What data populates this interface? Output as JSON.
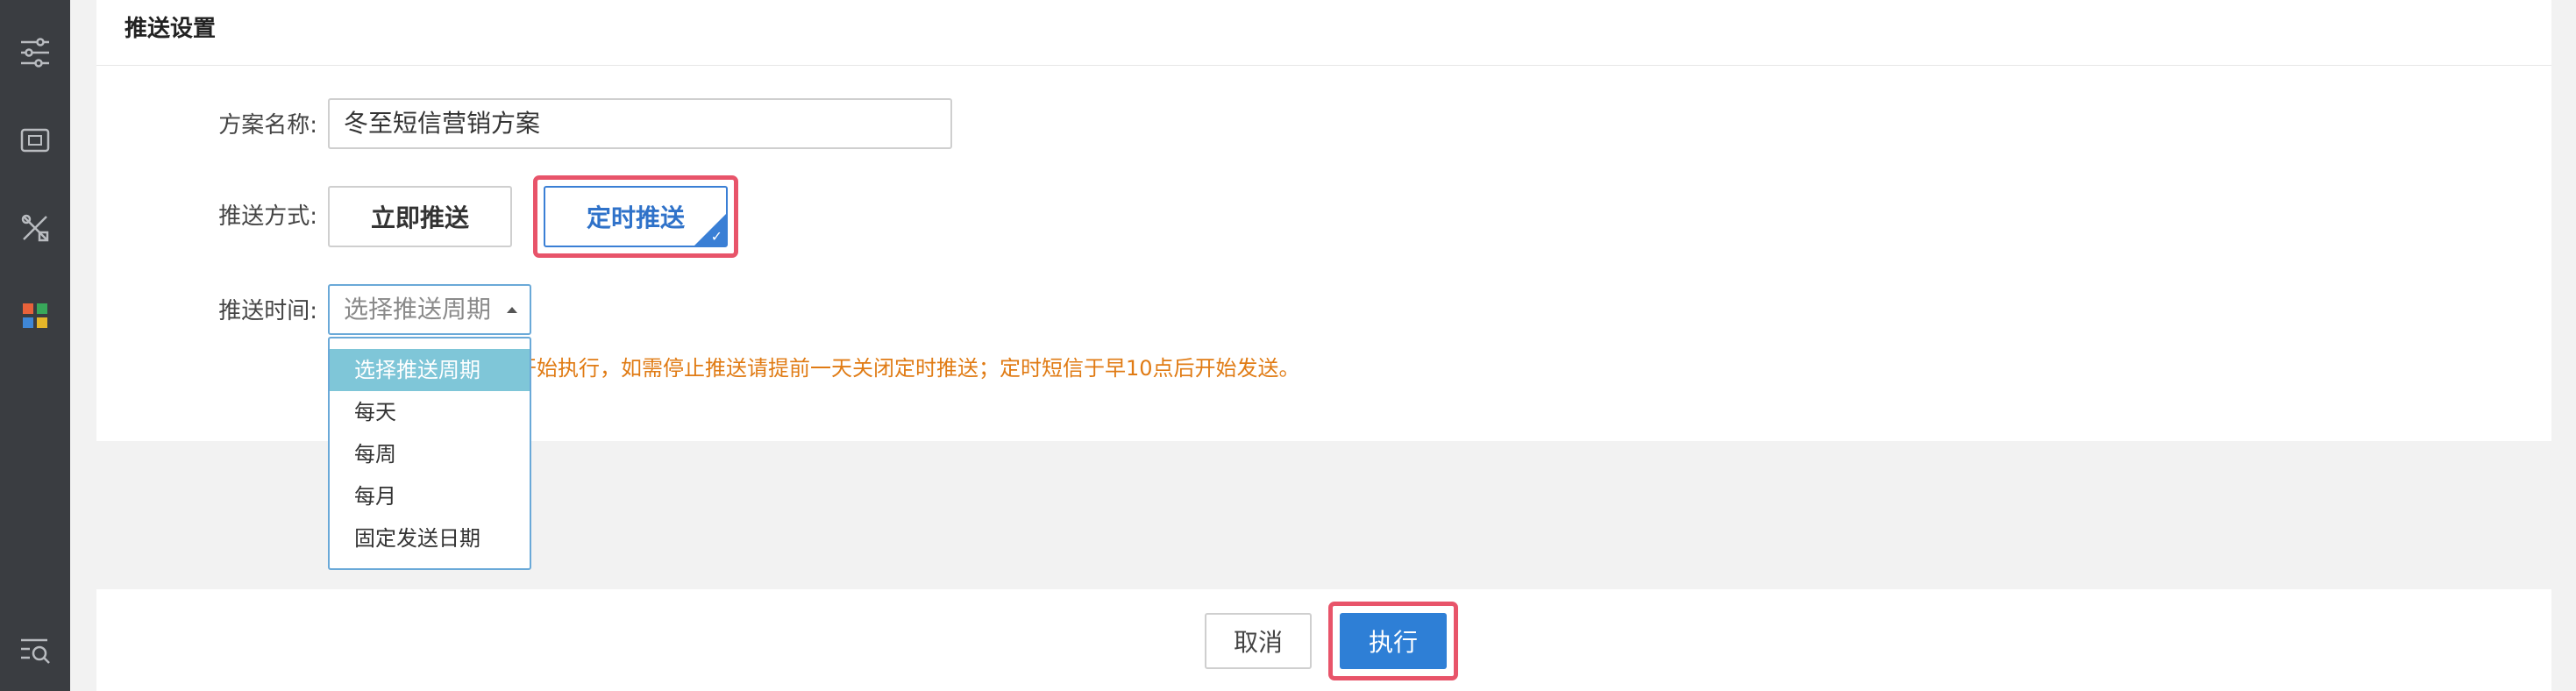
{
  "sidebar": {
    "icons": [
      "sliders-icon",
      "ticket-icon",
      "tools-icon",
      "apps-grid-icon",
      "search-list-icon"
    ],
    "accent_colors": [
      "#e8623a",
      "#38a85a",
      "#3f87d6",
      "#e6b629"
    ]
  },
  "section": {
    "title": "推送设置"
  },
  "form": {
    "plan_name_label": "方案名称:",
    "plan_name_value": "冬至短信营销方案",
    "push_mode_label": "推送方式:",
    "push_mode_options": [
      "立即推送",
      "定时推送"
    ],
    "push_mode_selected": "定时推送",
    "push_time_label": "推送时间:",
    "push_time_placeholder": "选择推送周期",
    "notice_text": "开始执行，如需停止推送请提前一天关闭定时推送；定时短信于早10点后开始发送。"
  },
  "dropdown": {
    "options": [
      "选择推送周期",
      "每天",
      "每周",
      "每月",
      "固定发送日期"
    ],
    "highlighted": "选择推送周期"
  },
  "footer": {
    "cancel_label": "取消",
    "execute_label": "执行"
  },
  "colors": {
    "primary": "#2e7fd6",
    "highlight_border": "#e8546a",
    "notice": "#e07b14",
    "dropdown_hover": "#7fc6d8"
  }
}
